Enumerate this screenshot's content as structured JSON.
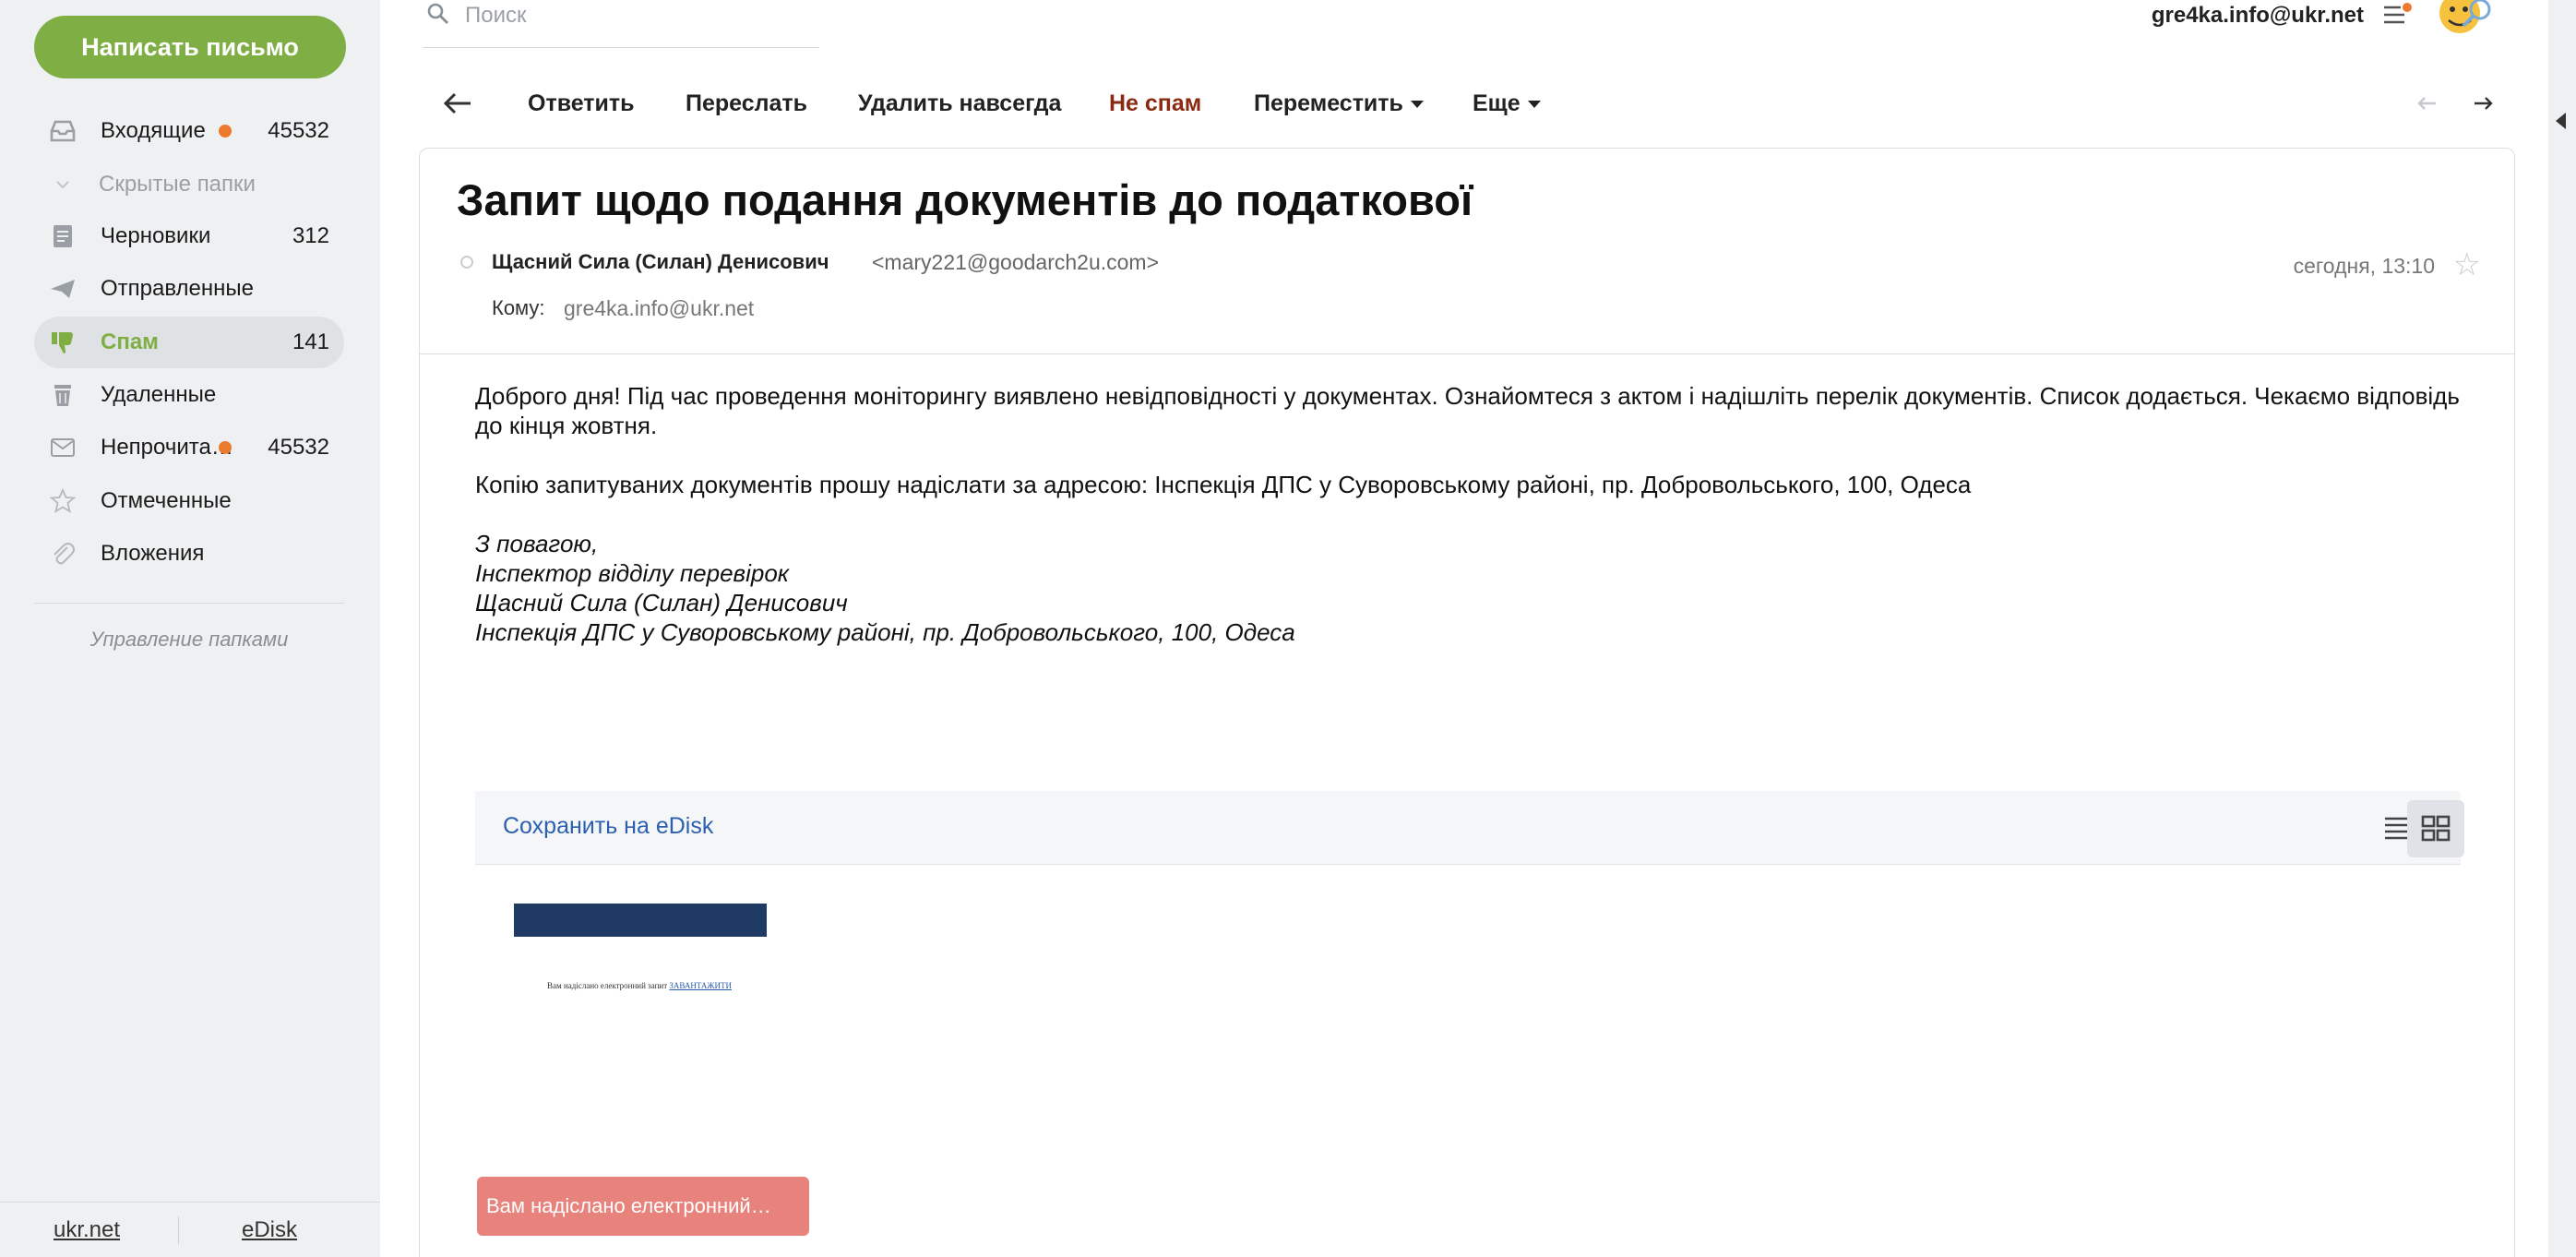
{
  "sidebar": {
    "compose_label": "Написать письмо",
    "folders": [
      {
        "label": "Входящие",
        "count": "45532",
        "icon": "inbox-icon",
        "unread": true
      },
      {
        "label": "Скрытые папки",
        "count": "",
        "icon": "chevron-down-icon"
      },
      {
        "label": "Черновики",
        "count": "312",
        "icon": "drafts-icon"
      },
      {
        "label": "Отправленные",
        "count": "",
        "icon": "send-icon"
      },
      {
        "label": "Спам",
        "count": "141",
        "icon": "thumbs-down-icon",
        "active": true
      },
      {
        "label": "Удаленные",
        "count": "",
        "icon": "trash-icon"
      },
      {
        "label": "Непрочита…",
        "count": "45532",
        "icon": "envelope-icon",
        "unread": true
      },
      {
        "label": "Отмеченные",
        "count": "",
        "icon": "star-icon"
      },
      {
        "label": "Вложения",
        "count": "",
        "icon": "paperclip-icon"
      }
    ],
    "manage_label": "Управление папками",
    "footer": {
      "link1": "ukr.net",
      "link2": "eDisk"
    }
  },
  "header": {
    "search_placeholder": "Поиск",
    "account": "gre4ka.info@ukr.net"
  },
  "toolbar": {
    "reply": "Ответить",
    "forward": "Переслать",
    "delete_forever": "Удалить навсегда",
    "not_spam": "Не спам",
    "move": "Переместить",
    "more": "Еще"
  },
  "message": {
    "subject": "Запит щодо подання документів до податкової",
    "sender_name": "Щасний Сила (Силан) Денисович",
    "sender_email": "<mary221@goodarch2u.com>",
    "to_label": "Кому:",
    "to_value": "gre4ka.info@ukr.net",
    "date": "сегодня, 13:10",
    "body_p1": "Доброго дня! Під час проведення моніторингу виявлено невідповідності у документах. Ознайомтеся з актом і надішліть перелік документів. Список додається. Чекаємо відповідь до кінця жовтня.",
    "body_p2": "Копію запитуваних документів прошу надіслати за адресою: Інспекція ДПС у Суворовському районі, пр. Добровольського, 100, Одеса",
    "sig1": "З повагою,",
    "sig2": "Інспектор відділу перевірок",
    "sig3": "Щасний Сила (Силан) Денисович",
    "sig4": "Інспекція ДПС у Суворовському районі, пр. Добровольського, 100, Одеса"
  },
  "attachments": {
    "save_label": "Сохранить на eDisk",
    "file_name": "Вам надіслано електронний…"
  },
  "colors": {
    "accent_green": "#7fae44",
    "unread_dot": "#ec7a2c",
    "link_blue": "#2c5fb0",
    "not_spam_red": "#8a2a12",
    "attachment_red": "#e7837c"
  }
}
